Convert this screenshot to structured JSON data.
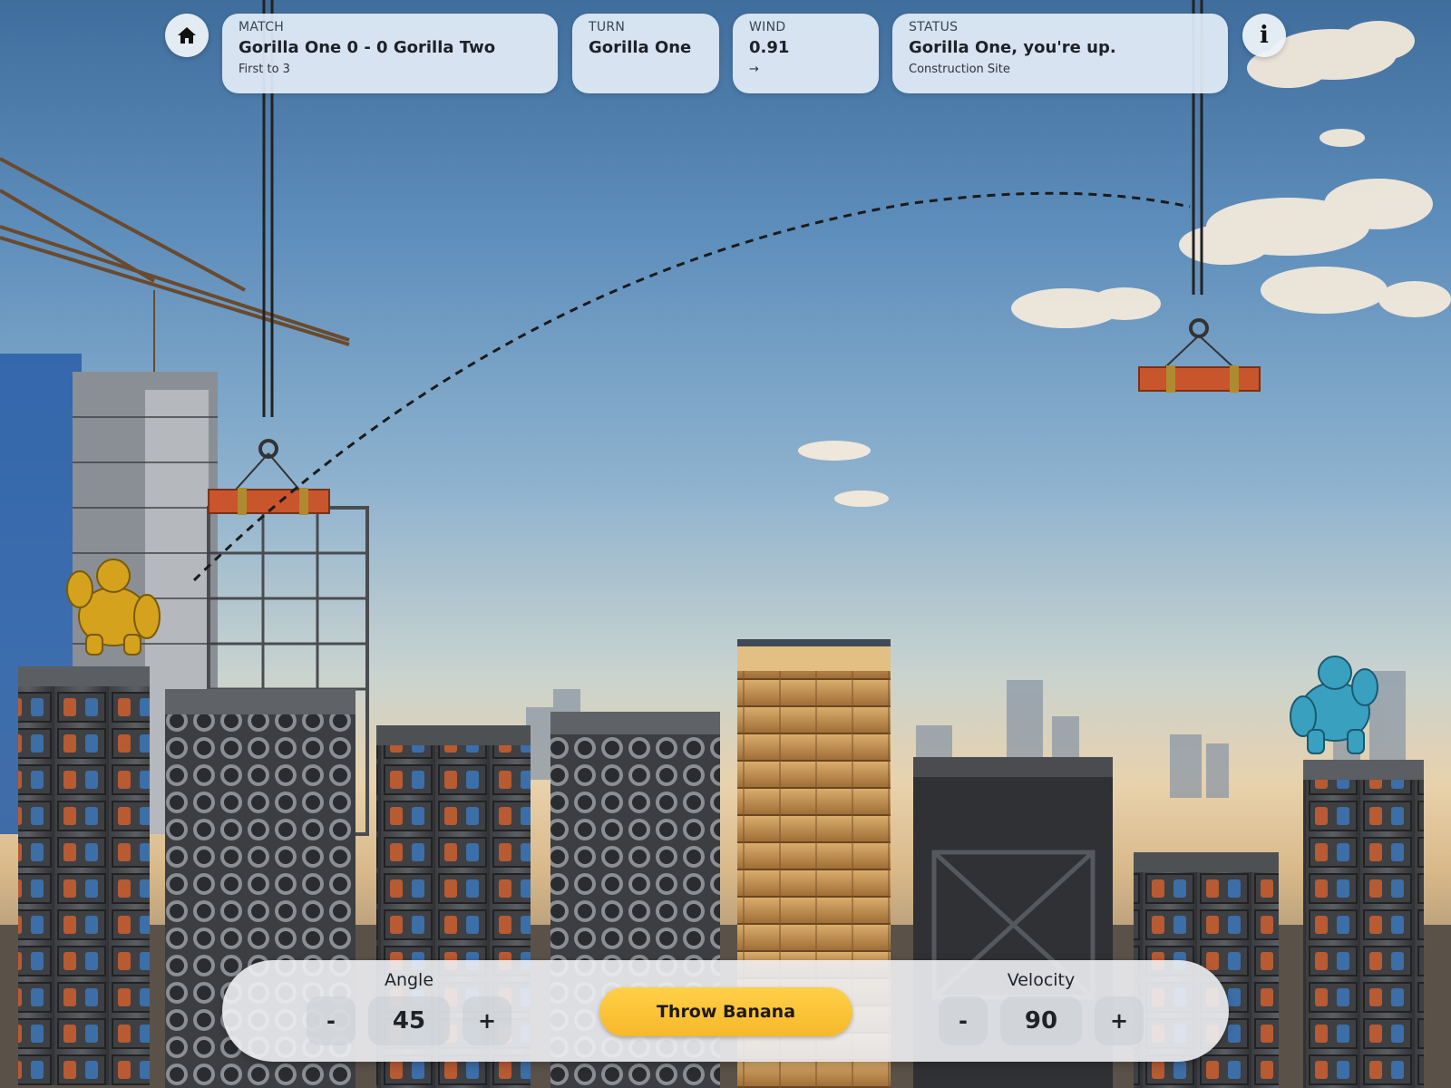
{
  "hud": {
    "match": {
      "key": "MATCH",
      "value": "Gorilla One 0 - 0 Gorilla Two",
      "sub": "First to 3"
    },
    "turn": {
      "key": "TURN",
      "value": "Gorilla One"
    },
    "wind": {
      "key": "WIND",
      "value": "0.91",
      "sub": "→"
    },
    "status": {
      "key": "STATUS",
      "value": "Gorilla One, you're up.",
      "sub": "Construction Site"
    }
  },
  "buttons": {
    "home_icon": "home-icon",
    "info_icon": "info-icon",
    "info_glyph": "i"
  },
  "controls": {
    "angle": {
      "label": "Angle",
      "value": "45",
      "minus": "-",
      "plus": "+"
    },
    "velocity": {
      "label": "Velocity",
      "value": "90",
      "minus": "-",
      "plus": "+"
    },
    "throw_label": "Throw Banana"
  },
  "players": {
    "one": {
      "color": "#d4a21c"
    },
    "two": {
      "color": "#3aa0c0"
    }
  },
  "colors": {
    "accent": "#f7b82a",
    "girder": "#c8552c"
  }
}
